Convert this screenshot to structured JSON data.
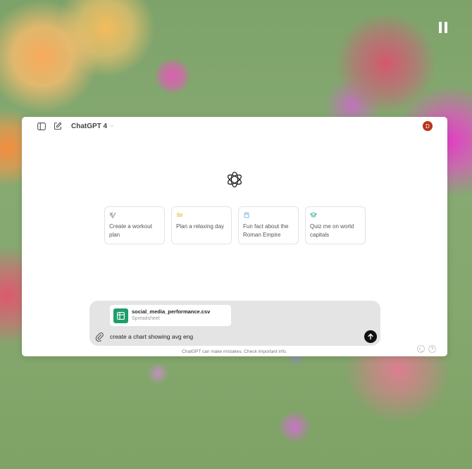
{
  "header": {
    "model_name": "ChatGPT 4",
    "avatar_initial": "D"
  },
  "suggestions": [
    {
      "label": "Create a workout plan",
      "icon": "dumbbell-icon",
      "color": "#8a8a8a"
    },
    {
      "label": "Plan a relaxing day",
      "icon": "lounge-chair-icon",
      "color": "#e2c541"
    },
    {
      "label": "Fun fact about the Roman Empire",
      "icon": "hat-icon",
      "color": "#7cb8e6"
    },
    {
      "label": "Quiz me on world capitals",
      "icon": "graduation-cap-icon",
      "color": "#4bb7a6"
    }
  ],
  "composer": {
    "attachment": {
      "file_name": "social_media_performance.csv",
      "file_type": "Spreadsheet",
      "icon": "spreadsheet-icon",
      "icon_color": "#1e9e6a"
    },
    "input_value": "create a chart showing avg eng"
  },
  "footer": {
    "disclaimer": "ChatGPT can make mistakes. Check important info.",
    "help_label": "?"
  },
  "colors": {
    "accent_send": "#111111",
    "avatar_bg": "#b8341a"
  }
}
